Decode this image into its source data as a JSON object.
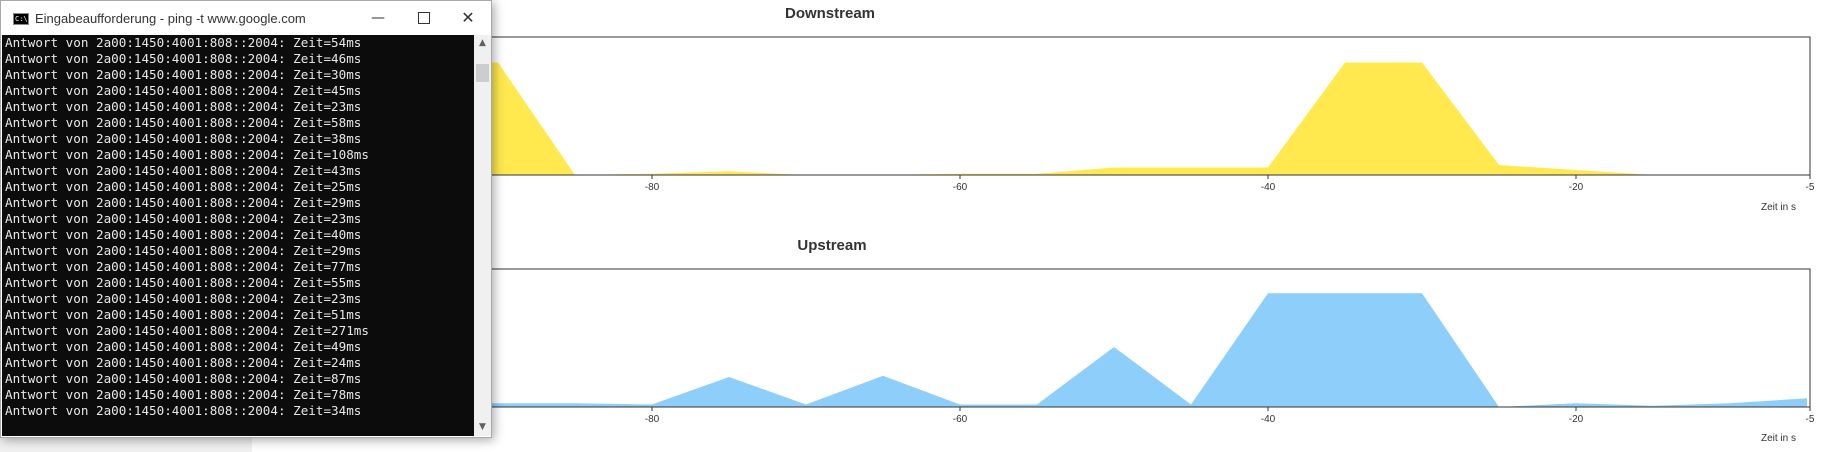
{
  "window": {
    "title": "Eingabeaufforderung - ping  -t www.google.com",
    "icon": "cmd-icon",
    "buttons": {
      "minimize": "—",
      "close": "✕"
    }
  },
  "console_lines": [
    "Antwort von 2a00:1450:4001:808::2004: Zeit=54ms",
    "Antwort von 2a00:1450:4001:808::2004: Zeit=46ms",
    "Antwort von 2a00:1450:4001:808::2004: Zeit=30ms",
    "Antwort von 2a00:1450:4001:808::2004: Zeit=45ms",
    "Antwort von 2a00:1450:4001:808::2004: Zeit=23ms",
    "Antwort von 2a00:1450:4001:808::2004: Zeit=58ms",
    "Antwort von 2a00:1450:4001:808::2004: Zeit=38ms",
    "Antwort von 2a00:1450:4001:808::2004: Zeit=108ms",
    "Antwort von 2a00:1450:4001:808::2004: Zeit=43ms",
    "Antwort von 2a00:1450:4001:808::2004: Zeit=25ms",
    "Antwort von 2a00:1450:4001:808::2004: Zeit=29ms",
    "Antwort von 2a00:1450:4001:808::2004: Zeit=23ms",
    "Antwort von 2a00:1450:4001:808::2004: Zeit=40ms",
    "Antwort von 2a00:1450:4001:808::2004: Zeit=29ms",
    "Antwort von 2a00:1450:4001:808::2004: Zeit=77ms",
    "Antwort von 2a00:1450:4001:808::2004: Zeit=55ms",
    "Antwort von 2a00:1450:4001:808::2004: Zeit=23ms",
    "Antwort von 2a00:1450:4001:808::2004: Zeit=51ms",
    "Antwort von 2a00:1450:4001:808::2004: Zeit=271ms",
    "Antwort von 2a00:1450:4001:808::2004: Zeit=49ms",
    "Antwort von 2a00:1450:4001:808::2004: Zeit=24ms",
    "Antwort von 2a00:1450:4001:808::2004: Zeit=87ms",
    "Antwort von 2a00:1450:4001:808::2004: Zeit=78ms",
    "Antwort von 2a00:1450:4001:808::2004: Zeit=34ms"
  ],
  "chart_data": [
    {
      "type": "area",
      "title": "Downstream",
      "xlabel": "Zeit in s",
      "ylabel": "",
      "xlim": [
        -90,
        -5
      ],
      "ylim": [
        0,
        1
      ],
      "xticks": [
        -80,
        -60,
        -40,
        -20,
        -5
      ],
      "grid": false,
      "color": "#ffe94f",
      "x": [
        -95,
        -90,
        -85,
        -80,
        -75,
        -70,
        -65,
        -60,
        -55,
        -50,
        -45,
        -40,
        -35,
        -30,
        -25,
        -20,
        -15,
        -10,
        -5
      ],
      "values": [
        0.9,
        0.9,
        0.0,
        0.01,
        0.03,
        0.0,
        0.0,
        0.01,
        0.01,
        0.06,
        0.06,
        0.06,
        0.9,
        0.9,
        0.08,
        0.04,
        0.0,
        0.0,
        0.0
      ]
    },
    {
      "type": "area",
      "title": "Upstream",
      "xlabel": "Zeit in s",
      "ylabel": "",
      "xlim": [
        -90,
        -5
      ],
      "ylim": [
        0,
        1
      ],
      "xticks": [
        -80,
        -60,
        -40,
        -20,
        -5
      ],
      "grid": false,
      "color": "#8dcffa",
      "x": [
        -95,
        -90,
        -85,
        -80,
        -75,
        -70,
        -65,
        -60,
        -55,
        -50,
        -45,
        -40,
        -35,
        -30,
        -25,
        -20,
        -15,
        -10,
        -5
      ],
      "values": [
        0.03,
        0.03,
        0.03,
        0.02,
        0.24,
        0.02,
        0.25,
        0.02,
        0.02,
        0.48,
        0.02,
        0.91,
        0.91,
        0.91,
        0.0,
        0.03,
        0.01,
        0.03,
        0.07
      ]
    }
  ]
}
